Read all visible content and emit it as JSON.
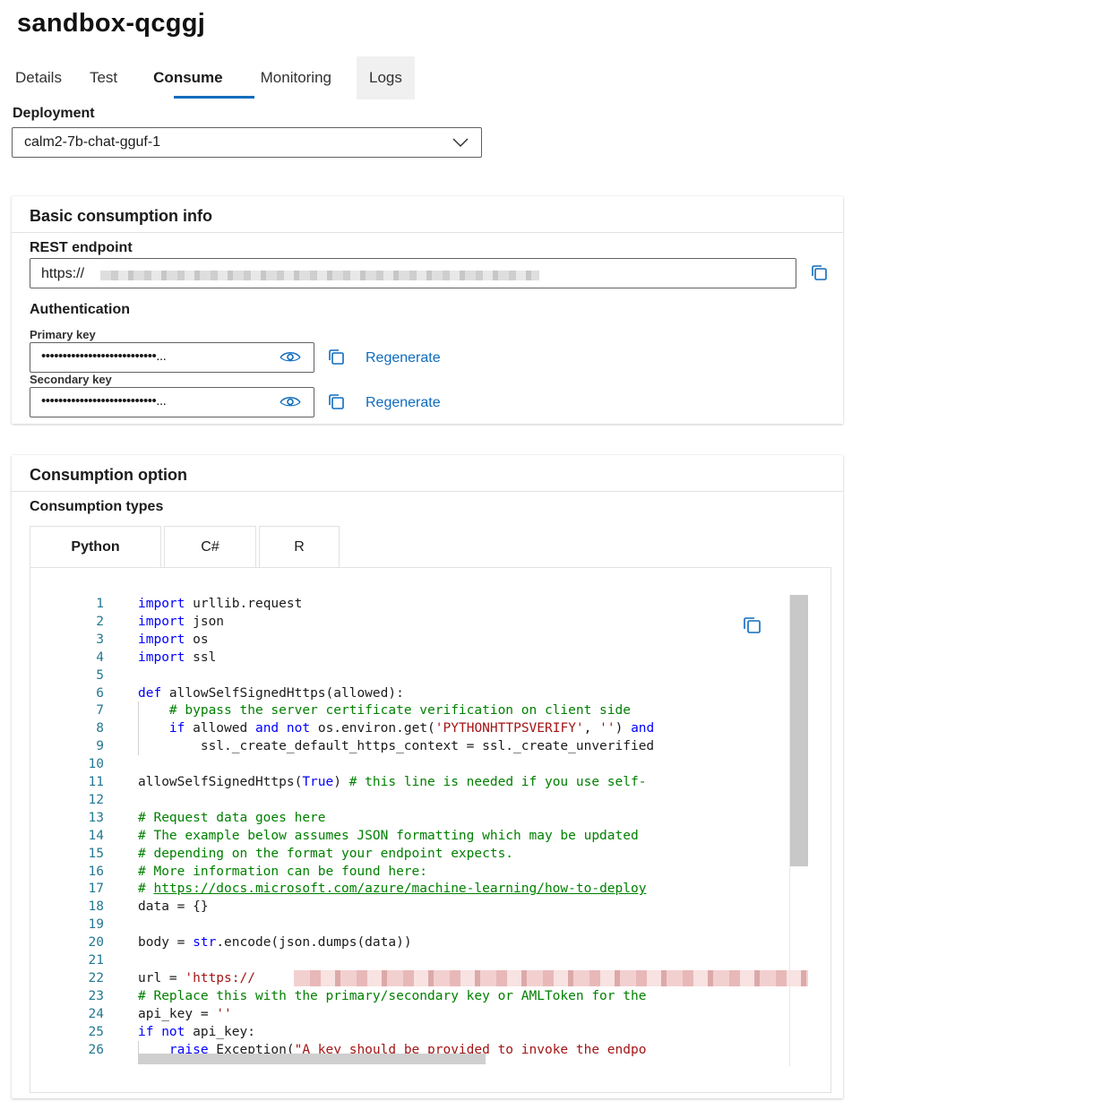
{
  "page": {
    "title": "sandbox-qcggj"
  },
  "tabs": [
    {
      "label": "Details"
    },
    {
      "label": "Test"
    },
    {
      "label": "Consume"
    },
    {
      "label": "Monitoring"
    },
    {
      "label": "Logs"
    }
  ],
  "active_tab": "Consume",
  "deployment": {
    "label": "Deployment",
    "value": "calm2-7b-chat-gguf-1"
  },
  "basic_info": {
    "title": "Basic consumption info",
    "rest_label": "REST endpoint",
    "rest_value": "https://",
    "auth_label": "Authentication",
    "primary_label": "Primary key",
    "primary_value": "•••••••••••••••••••••••••••...",
    "secondary_label": "Secondary key",
    "secondary_value": "•••••••••••••••••••••••••••...",
    "regenerate_label": "Regenerate"
  },
  "consumption": {
    "title": "Consumption option",
    "types_label": "Consumption types",
    "types": [
      {
        "label": "Python"
      },
      {
        "label": "C#"
      },
      {
        "label": "R"
      }
    ],
    "active_type": "Python"
  },
  "code": {
    "line_numbers": [
      "1",
      "2",
      "3",
      "4",
      "5",
      "6",
      "7",
      "8",
      "9",
      "10",
      "11",
      "12",
      "13",
      "14",
      "15",
      "16",
      "17",
      "18",
      "19",
      "20",
      "21",
      "22",
      "23",
      "24",
      "25",
      "26"
    ],
    "lines": [
      "import urllib.request",
      "import json",
      "import os",
      "import ssl",
      "",
      "def allowSelfSignedHttps(allowed):",
      "    # bypass the server certificate verification on client side",
      "    if allowed and not os.environ.get('PYTHONHTTPSVERIFY', '') and",
      "        ssl._create_default_https_context = ssl._create_unverified",
      "",
      "allowSelfSignedHttps(True) # this line is needed if you use self-",
      "",
      "# Request data goes here",
      "# The example below assumes JSON formatting which may be updated",
      "# depending on the format your endpoint expects.",
      "# More information can be found here:",
      "# https://docs.microsoft.com/azure/machine-learning/how-to-deploy",
      "data = {}",
      "",
      "body = str.encode(json.dumps(data))",
      "",
      "url = 'https://",
      "# Replace this with the primary/secondary key or AMLToken for the",
      "api_key = ''",
      "if not api_key:",
      "    raise Exception(\"A key should be provided to invoke the endpo"
    ]
  },
  "colors": {
    "accent": "#0f6cbd",
    "keyword": "#0000ff",
    "comment": "#008000",
    "string": "#a31515",
    "line_number": "#237893"
  }
}
